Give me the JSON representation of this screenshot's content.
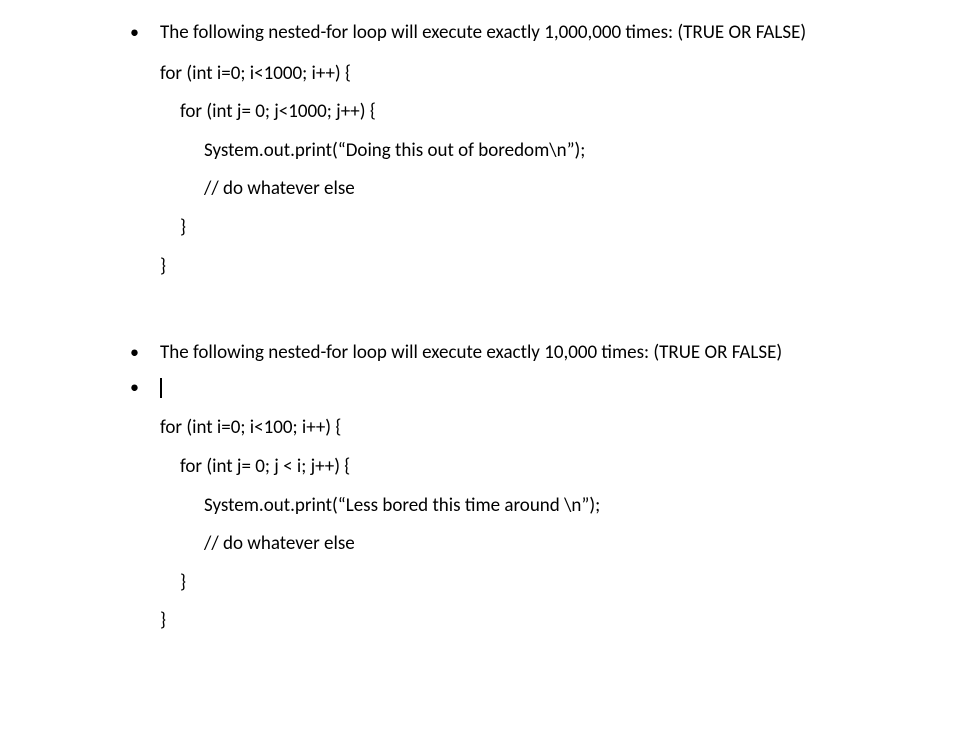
{
  "q1": {
    "prompt": "The following nested-for loop will execute exactly 1,000,000 times: (TRUE OR FALSE)",
    "code": {
      "l1": "for (int i=0; i<1000; i++) {",
      "l2": "for (int j= 0; j<1000; j++) {",
      "l3": "System.out.print(“Doing this out of boredom\\n”);",
      "l4": "// do whatever else",
      "l5": "}",
      "l6": "}"
    }
  },
  "q2": {
    "prompt": " The following nested-for loop will execute exactly 10,000 times: (TRUE OR FALSE)",
    "code": {
      "l1": "for (int i=0; i<100; i++) {",
      "l2": "for (int j= 0; j < i; j++) {",
      "l3": "System.out.print(“Less bored this time around \\n”);",
      "l4": "// do whatever else",
      "l5": "}",
      "l6": "}"
    }
  }
}
